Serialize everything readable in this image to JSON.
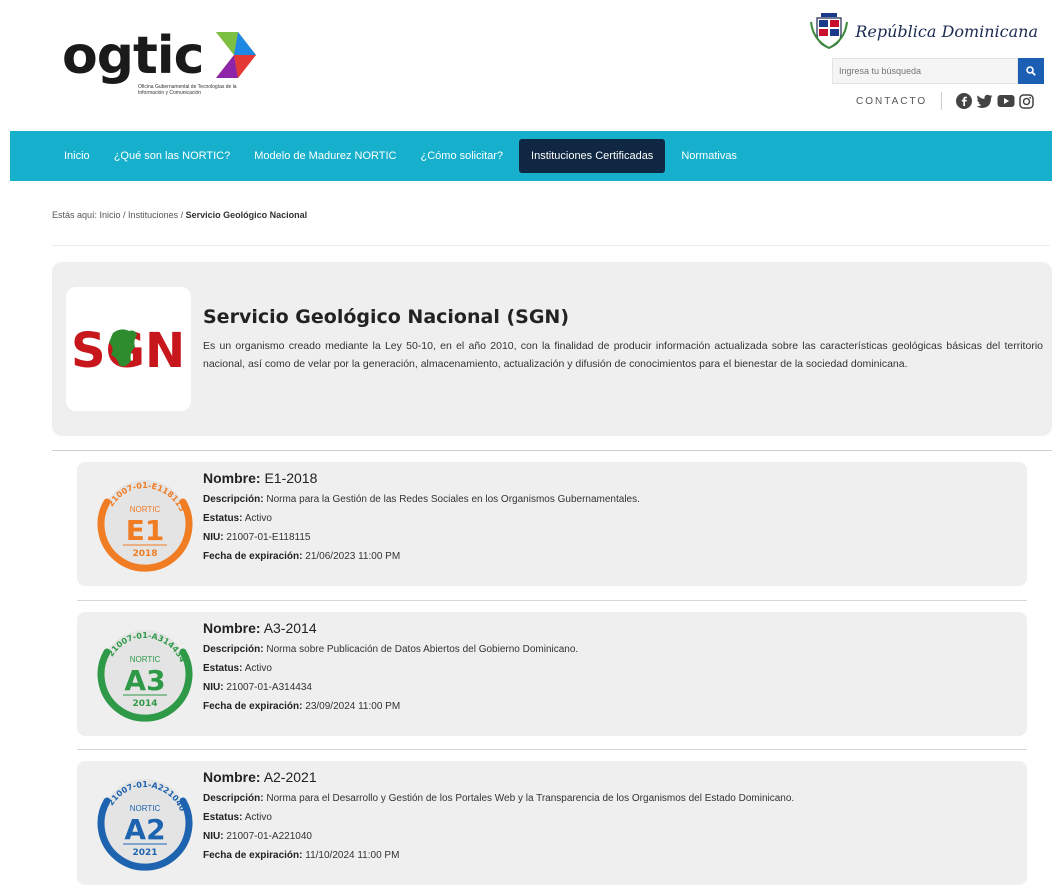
{
  "header": {
    "logo_text": "ogtic",
    "logo_subtitle": "Oficina Gubernamental de Tecnologías de la Información y Comunicación",
    "country_text": "República Dominicana",
    "search_placeholder": "Ingresa tu búsqueda",
    "contact_label": "CONTACTO",
    "social_icons": [
      "facebook-icon",
      "twitter-icon",
      "youtube-icon",
      "instagram-icon"
    ]
  },
  "nav": {
    "items": [
      {
        "label": "Inicio",
        "active": false
      },
      {
        "label": "¿Qué son las NORTIC?",
        "active": false
      },
      {
        "label": "Modelo de Madurez NORTIC",
        "active": false
      },
      {
        "label": "¿Cómo solicitar?",
        "active": false
      },
      {
        "label": "Instituciones Certificadas",
        "active": true
      },
      {
        "label": "Normativas",
        "active": false
      }
    ]
  },
  "breadcrumb": {
    "prefix": "Estás aquí:",
    "trail": "Inicio / Instituciones /",
    "current": "Servicio Geológico Nacional"
  },
  "institution": {
    "title": "Servicio Geológico Nacional (SGN)",
    "description": "Es un organismo creado mediante la Ley 50-10, en el año 2010, con la finalidad de producir información actualizada sobre las características geológicas básicas del territorio nacional, así como de velar por la generación, almacenamiento, actualización y difusión de conocimientos para el bienestar de la sociedad dominicana.",
    "logo_text": "SGN"
  },
  "labels": {
    "name": "Nombre:",
    "description": "Descripción:",
    "status": "Estatus:",
    "niu": "NIU:",
    "expiration": "Fecha de expiración:"
  },
  "norms": [
    {
      "name": "E1-2018",
      "description": "Norma para la Gestión de las Redes Sociales en los Organismos Gubernamentales.",
      "status": "Activo",
      "niu": "21007-01-E118115",
      "expiration": "21/06/2023 11:00 PM",
      "badge": {
        "code": "E1",
        "year": "2018",
        "top": "NORTIC",
        "arc_text": "21007-01-E118115",
        "color": "#f07c23"
      }
    },
    {
      "name": "A3-2014",
      "description": "Norma sobre Publicación de Datos Abiertos del Gobierno Dominicano.",
      "status": "Activo",
      "niu": "21007-01-A314434",
      "expiration": "23/09/2024 11:00 PM",
      "badge": {
        "code": "A3",
        "year": "2014",
        "top": "NORTIC",
        "arc_text": "21007-01-A314434",
        "color": "#2e9a48"
      }
    },
    {
      "name": "A2-2021",
      "description": "Norma para el Desarrollo y Gestión de los Portales Web y la Transparencia de los Organismos del Estado Dominicano.",
      "status": "Activo",
      "niu": "21007-01-A221040",
      "expiration": "11/10/2024 11:00 PM",
      "badge": {
        "code": "A2",
        "year": "2021",
        "top": "NORTIC",
        "arc_text": "21007-01-A221040",
        "color": "#1e63b0"
      }
    }
  ],
  "colors": {
    "nav_bg": "#17b0cc",
    "nav_active_bg": "#0f2742",
    "search_button": "#1b5fb5",
    "card_bg": "#efefef"
  }
}
